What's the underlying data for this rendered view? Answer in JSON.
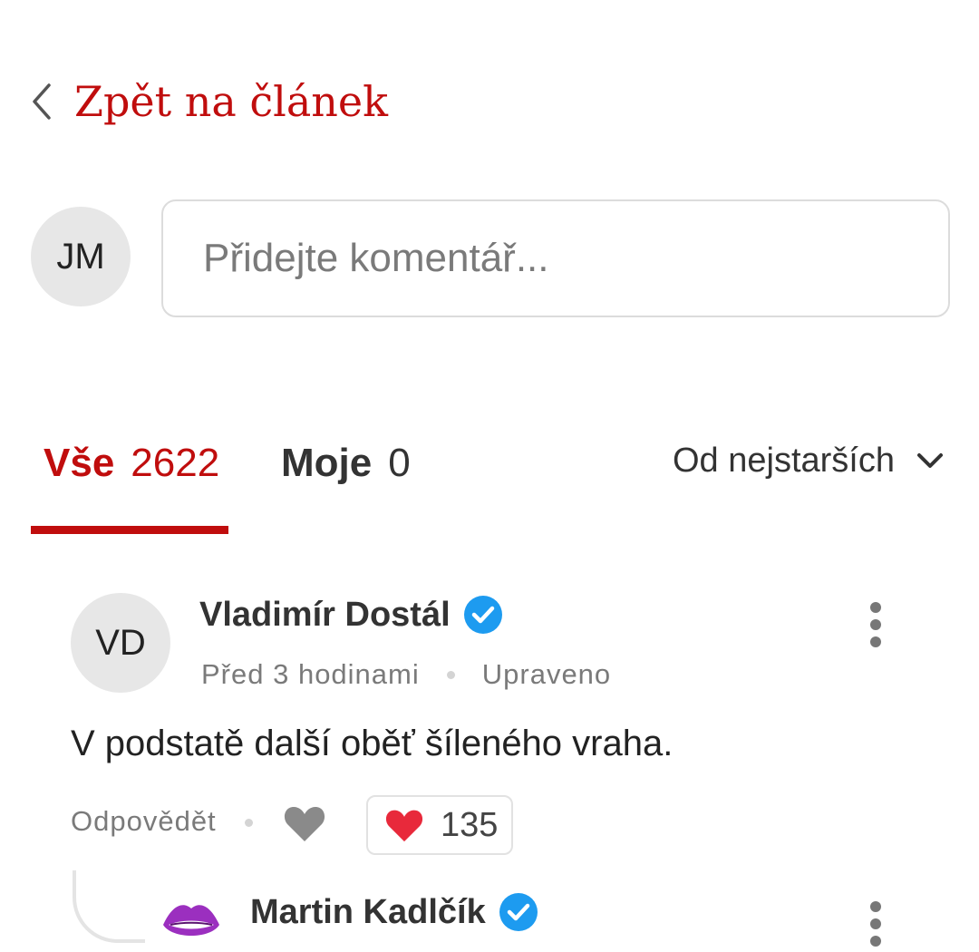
{
  "back": {
    "label": "Zpět na článek"
  },
  "composer": {
    "avatar_initials": "JM",
    "placeholder": "Přidejte komentář..."
  },
  "tabs": [
    {
      "label": "Vše",
      "count": "2622",
      "active": true
    },
    {
      "label": "Moje",
      "count": "0",
      "active": false
    }
  ],
  "sort": {
    "label": "Od nejstarších"
  },
  "comments": [
    {
      "avatar_initials": "VD",
      "author": "Vladimír Dostál",
      "verified": true,
      "time": "Před 3 hodinami",
      "edited": "Upraveno",
      "text": "V podstatě další oběť šíleného vraha.",
      "reply_label": "Odpovědět",
      "reaction_count": "135"
    }
  ],
  "reply": {
    "author": "Martin Kadlčík",
    "verified": true,
    "avatar_icon": "lips-icon"
  },
  "colors": {
    "accent": "#c00d0d",
    "verified": "#1d9bf0",
    "heart": "#e8293b",
    "avatar_bg": "#e7e7e7"
  }
}
